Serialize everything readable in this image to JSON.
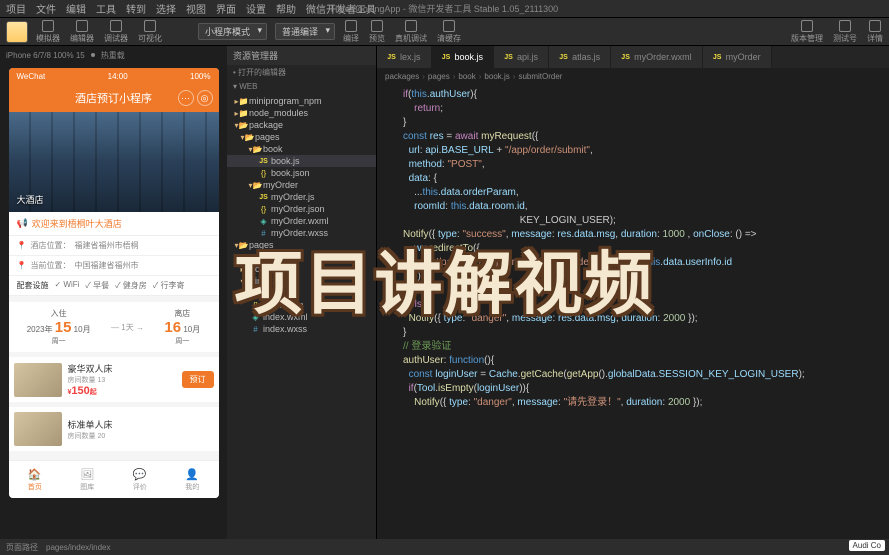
{
  "menu": {
    "items": [
      "项目",
      "文件",
      "编辑",
      "工具",
      "转到",
      "选择",
      "视图",
      "界面",
      "设置",
      "帮助",
      "微信开发者工具"
    ],
    "title": "HotelBookingApp - 微信开发者工具 Stable 1.05_2111300"
  },
  "toolbar": {
    "modes": [
      "模拟器",
      "编辑器",
      "调试器",
      "可视化"
    ],
    "compile_mode": "小程序模式",
    "compile": "普通编译",
    "actions": [
      "编译",
      "预览",
      "真机调试",
      "清缓存"
    ],
    "right": [
      "版本管理",
      "测试号",
      "详情"
    ]
  },
  "sim_head": {
    "device": "iPhone 6/7/8 100% 15",
    "hot": "热重载"
  },
  "phone": {
    "status": {
      "carrier": "WeChat",
      "time": "14:00",
      "battery": "100%"
    },
    "title": "酒店预订小程序",
    "hotel_name": "大酒店",
    "welcome": "欢迎来到梧桐叶大酒店",
    "addr_label": "酒店位置：",
    "addr": "福建省福州市梧桐",
    "curr_label": "当前位置：",
    "curr": "中国福建省福州市",
    "amenities": [
      "配套设施",
      "WiFi",
      "早餐",
      "健身房",
      "行李寄"
    ],
    "checkin": "入住",
    "checkout": "离店",
    "date1_year": "2023年",
    "date1_day": "15",
    "date1_month": "10月",
    "date1_wd": "周一",
    "nights": "1天",
    "date2_day": "16",
    "date2_month": "10月",
    "date2_wd": "周一",
    "rooms": [
      {
        "name": "豪华双人床",
        "stock": "房间数量  13",
        "price": "150",
        "unit": "起",
        "btn": "预订"
      },
      {
        "name": "标准单人床",
        "stock": "房间数量  20",
        "price": "",
        "unit": "",
        "btn": ""
      }
    ],
    "tabs": [
      "首页",
      "图库",
      "评价",
      "我的"
    ]
  },
  "explorer": {
    "title": "资源管理器",
    "open_editors": "打开的编辑器",
    "root": "WEB",
    "tree": [
      {
        "l": 0,
        "t": "f",
        "n": "miniprogram_npm"
      },
      {
        "l": 0,
        "t": "f",
        "n": "node_modules"
      },
      {
        "l": 0,
        "t": "fo",
        "n": "package"
      },
      {
        "l": 1,
        "t": "fo",
        "n": "pages"
      },
      {
        "l": 2,
        "t": "fo",
        "n": "book"
      },
      {
        "l": 3,
        "t": "js",
        "n": "book.js",
        "active": true
      },
      {
        "l": 3,
        "t": "json",
        "n": "book.json"
      },
      {
        "l": 2,
        "t": "fo",
        "n": "myOrder"
      },
      {
        "l": 3,
        "t": "js",
        "n": "myOrder.js"
      },
      {
        "l": 3,
        "t": "json",
        "n": "myOrder.json"
      },
      {
        "l": 3,
        "t": "wxml",
        "n": "myOrder.wxml"
      },
      {
        "l": 3,
        "t": "wxss",
        "n": "myOrder.wxss"
      },
      {
        "l": 0,
        "t": "fo",
        "n": "pages"
      },
      {
        "l": 1,
        "t": "f",
        "n": "atlas"
      },
      {
        "l": 1,
        "t": "f",
        "n": "comment"
      },
      {
        "l": 1,
        "t": "fo",
        "n": "index"
      },
      {
        "l": 2,
        "t": "js",
        "n": "index.js"
      },
      {
        "l": 2,
        "t": "json",
        "n": "index.json"
      },
      {
        "l": 2,
        "t": "wxml",
        "n": "index.wxml"
      },
      {
        "l": 2,
        "t": "wxss",
        "n": "index.wxss"
      }
    ]
  },
  "editor": {
    "tabs": [
      {
        "n": "lex.js"
      },
      {
        "n": "book.js",
        "active": true
      },
      {
        "n": "api.js"
      },
      {
        "n": "atlas.js"
      },
      {
        "n": "myOrder.wxml"
      },
      {
        "n": "myOrder"
      }
    ],
    "crumb": [
      "packages",
      "pages",
      "book",
      "book.js",
      "submitOrder"
    ],
    "code": [
      {
        "n": "",
        "t": [
          [
            "kw",
            "if"
          ],
          [
            "pn",
            "("
          ],
          [
            "this",
            "this"
          ],
          [
            "pn",
            "."
          ],
          [
            "prop",
            "authUser"
          ],
          [
            "pn",
            "){"
          ]
        ]
      },
      {
        "n": "",
        "t": [
          [
            "pn",
            "    "
          ],
          [
            "kw",
            "return"
          ],
          [
            "pn",
            ";"
          ]
        ]
      },
      {
        "n": "",
        "t": [
          [
            "pn",
            "}"
          ]
        ]
      },
      {
        "n": "",
        "t": []
      },
      {
        "n": "",
        "t": [
          [
            "var",
            "const "
          ],
          [
            "prop",
            "res"
          ],
          [
            "pn",
            " = "
          ],
          [
            "kw",
            "await "
          ],
          [
            "fn",
            "myRequest"
          ],
          [
            "pn",
            "({"
          ]
        ]
      },
      {
        "n": "",
        "t": [
          [
            "pn",
            "  "
          ],
          [
            "prop",
            "url"
          ],
          [
            "pn",
            ": "
          ],
          [
            "prop",
            "api"
          ],
          [
            "pn",
            "."
          ],
          [
            "prop",
            "BASE_URL"
          ],
          [
            "pn",
            " + "
          ],
          [
            "str",
            "\"/app/order/submit\""
          ],
          [
            "pn",
            ","
          ]
        ]
      },
      {
        "n": "",
        "t": [
          [
            "pn",
            "  "
          ],
          [
            "prop",
            "method"
          ],
          [
            "pn",
            ": "
          ],
          [
            "str",
            "\"POST\""
          ],
          [
            "pn",
            ","
          ]
        ]
      },
      {
        "n": "",
        "t": [
          [
            "pn",
            "  "
          ],
          [
            "prop",
            "data"
          ],
          [
            "pn",
            ": {"
          ]
        ]
      },
      {
        "n": "",
        "t": [
          [
            "pn",
            "    ..."
          ],
          [
            "this",
            "this"
          ],
          [
            "pn",
            "."
          ],
          [
            "prop",
            "data"
          ],
          [
            "pn",
            "."
          ],
          [
            "prop",
            "orderParam"
          ],
          [
            "pn",
            ","
          ]
        ]
      },
      {
        "n": "",
        "t": [
          [
            "pn",
            "    "
          ],
          [
            "prop",
            "roomId"
          ],
          [
            "pn",
            ": "
          ],
          [
            "this",
            "this"
          ],
          [
            "pn",
            "."
          ],
          [
            "prop",
            "data"
          ],
          [
            "pn",
            "."
          ],
          [
            "prop",
            "room"
          ],
          [
            "pn",
            "."
          ],
          [
            "prop",
            "id"
          ],
          [
            "pn",
            ","
          ]
        ]
      },
      {
        "n": "",
        "t": []
      },
      {
        "n": "",
        "t": [
          [
            "pn",
            "                                          KEY_LOGIN_USER);"
          ]
        ]
      },
      {
        "n": "",
        "t": []
      },
      {
        "n": "",
        "t": [
          [
            "fn",
            "Notify"
          ],
          [
            "pn",
            "({ "
          ],
          [
            "prop",
            "type"
          ],
          [
            "pn",
            ": "
          ],
          [
            "str",
            "\"success\""
          ],
          [
            "pn",
            ", "
          ],
          [
            "prop",
            "message"
          ],
          [
            "pn",
            ": "
          ],
          [
            "prop",
            "res"
          ],
          [
            "pn",
            "."
          ],
          [
            "prop",
            "data"
          ],
          [
            "pn",
            "."
          ],
          [
            "prop",
            "msg"
          ],
          [
            "pn",
            ", "
          ],
          [
            "prop",
            "duration"
          ],
          [
            "pn",
            ": "
          ],
          [
            "num",
            "1000"
          ],
          [
            "pn",
            " , "
          ],
          [
            "prop",
            "onClose"
          ],
          [
            "pn",
            ": () =>"
          ]
        ]
      },
      {
        "n": "",
        "t": [
          [
            "pn",
            "    "
          ],
          [
            "prop",
            "wx"
          ],
          [
            "pn",
            "."
          ],
          [
            "fn",
            "redirectTo"
          ],
          [
            "pn",
            "({"
          ]
        ]
      },
      {
        "n": "",
        "t": [
          [
            "pn",
            "      "
          ],
          [
            "prop",
            "url"
          ],
          [
            "pn",
            ": "
          ],
          [
            "str",
            "'/package/pages/myOrder/myOrder?userId='"
          ],
          [
            "pn",
            " + "
          ],
          [
            "this",
            "this"
          ],
          [
            "pn",
            "."
          ],
          [
            "prop",
            "data"
          ],
          [
            "pn",
            "."
          ],
          [
            "prop",
            "userInfo"
          ],
          [
            "pn",
            "."
          ],
          [
            "prop",
            "id"
          ]
        ]
      },
      {
        "n": "",
        "t": [
          [
            "pn",
            "    })"
          ]
        ]
      },
      {
        "n": "",
        "t": [
          [
            "pn",
            "  })"
          ]
        ]
      },
      {
        "n": "",
        "t": [
          [
            "pn",
            "} "
          ],
          [
            "kw",
            "else"
          ],
          [
            "pn",
            " {"
          ]
        ]
      },
      {
        "n": "",
        "t": [
          [
            "pn",
            "  "
          ],
          [
            "fn",
            "Notify"
          ],
          [
            "pn",
            "({ "
          ],
          [
            "prop",
            "type"
          ],
          [
            "pn",
            ": "
          ],
          [
            "str",
            "\"danger\""
          ],
          [
            "pn",
            ", "
          ],
          [
            "prop",
            "message"
          ],
          [
            "pn",
            ": "
          ],
          [
            "prop",
            "res"
          ],
          [
            "pn",
            "."
          ],
          [
            "prop",
            "data"
          ],
          [
            "pn",
            "."
          ],
          [
            "prop",
            "msg"
          ],
          [
            "pn",
            ", "
          ],
          [
            "prop",
            "duration"
          ],
          [
            "pn",
            ": "
          ],
          [
            "num",
            "2000"
          ],
          [
            "pn",
            " });"
          ]
        ]
      },
      {
        "n": "",
        "t": [
          [
            "pn",
            "}"
          ]
        ]
      },
      {
        "n": "",
        "t": []
      },
      {
        "n": "",
        "t": [
          [
            "com",
            "// 登录验证"
          ]
        ]
      },
      {
        "n": "",
        "t": [
          [
            "fn",
            "authUser"
          ],
          [
            "pn",
            ": "
          ],
          [
            "var",
            "function"
          ],
          [
            "pn",
            "(){"
          ]
        ]
      },
      {
        "n": "",
        "t": [
          [
            "pn",
            "  "
          ],
          [
            "var",
            "const "
          ],
          [
            "prop",
            "loginUser"
          ],
          [
            "pn",
            " = "
          ],
          [
            "prop",
            "Cache"
          ],
          [
            "pn",
            "."
          ],
          [
            "fn",
            "getCache"
          ],
          [
            "pn",
            "("
          ],
          [
            "fn",
            "getApp"
          ],
          [
            "pn",
            "()."
          ],
          [
            "prop",
            "globalData"
          ],
          [
            "pn",
            "."
          ],
          [
            "prop",
            "SESSION_KEY_LOGIN_USER"
          ],
          [
            "pn",
            ");"
          ]
        ]
      },
      {
        "n": "",
        "t": [
          [
            "pn",
            "  "
          ],
          [
            "kw",
            "if"
          ],
          [
            "pn",
            "("
          ],
          [
            "prop",
            "Tool"
          ],
          [
            "pn",
            "."
          ],
          [
            "fn",
            "isEmpty"
          ],
          [
            "pn",
            "("
          ],
          [
            "prop",
            "loginUser"
          ],
          [
            "pn",
            ")){"
          ]
        ]
      },
      {
        "n": "",
        "t": [
          [
            "pn",
            "    "
          ],
          [
            "fn",
            "Notify"
          ],
          [
            "pn",
            "({ "
          ],
          [
            "prop",
            "type"
          ],
          [
            "pn",
            ": "
          ],
          [
            "str",
            "\"danger\""
          ],
          [
            "pn",
            ", "
          ],
          [
            "prop",
            "message"
          ],
          [
            "pn",
            ": "
          ],
          [
            "str",
            "\"请先登录！\""
          ],
          [
            "pn",
            ", "
          ],
          [
            "prop",
            "duration"
          ],
          [
            "pn",
            ": "
          ],
          [
            "num",
            "2000"
          ],
          [
            "pn",
            " });"
          ]
        ]
      }
    ]
  },
  "statusbar": {
    "left": "页面路径",
    "path": "pages/index/index"
  },
  "overlay": "项目讲解视频",
  "audi": "Audi Co"
}
